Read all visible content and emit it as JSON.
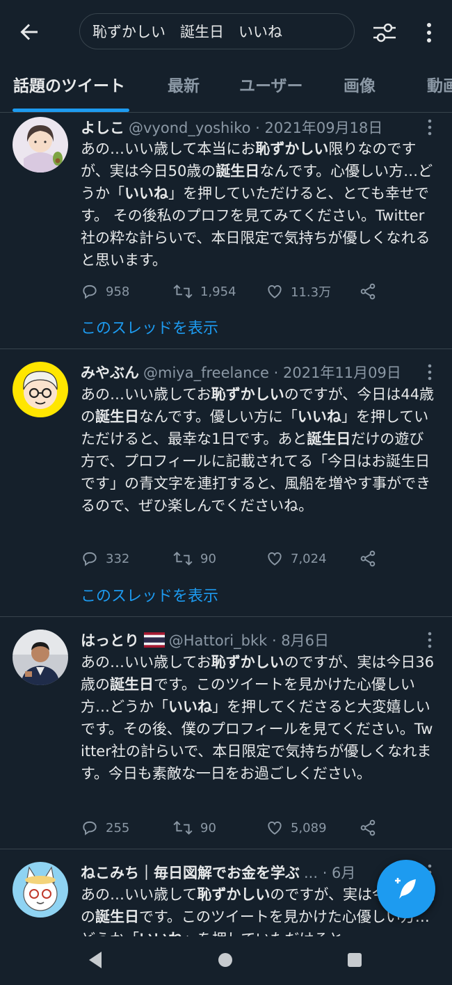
{
  "search": {
    "value": "恥ずかしい　誕生日　いいね"
  },
  "tabs": [
    {
      "label": "話題のツイート"
    },
    {
      "label": "最新"
    },
    {
      "label": "ユーザー"
    },
    {
      "label": "画像"
    },
    {
      "label": "動画"
    }
  ],
  "tweets": [
    {
      "name": "よしこ",
      "handle": "@vyond_yoshiko · 2021年09月18日",
      "text": [
        {
          "t": "あの…いい歳して本当にお"
        },
        {
          "t": "恥ずかしい",
          "b": true
        },
        {
          "t": "限りなのですが、実は今日50歳の"
        },
        {
          "t": "誕生日",
          "b": true
        },
        {
          "t": "なんです。心優しい方…どうか「"
        },
        {
          "t": "いいね",
          "b": true
        },
        {
          "t": "」を押していただけると、とても幸せです。 その後私のプロフを見てみてください。Twitter社の粋な計らいで、本日限定で気持ちが優しくなれると思います。"
        }
      ],
      "replies": "958",
      "retweets": "1,954",
      "likes": "11.3万",
      "thread_label": "このスレッドを表示"
    },
    {
      "name": "みやぶん",
      "handle": "@miya_freelance · 2021年11月09日",
      "text": [
        {
          "t": "あの…いい歳してお"
        },
        {
          "t": "恥ずかしい",
          "b": true
        },
        {
          "t": "のですが、今日は44歳の"
        },
        {
          "t": "誕生日",
          "b": true
        },
        {
          "t": "なんです。優しい方に「"
        },
        {
          "t": "いいね",
          "b": true
        },
        {
          "t": "」を押していただけると、最幸な1日です。あと"
        },
        {
          "t": "誕生日",
          "b": true
        },
        {
          "t": "だけの遊び方で、プロフィールに記載されてる「今日はお誕生日です」の青文字を連打すると、風船を増やす事ができるので、ぜひ楽しんでくださいね。"
        }
      ],
      "replies": "332",
      "retweets": "90",
      "likes": "7,024",
      "thread_label": "このスレッドを表示"
    },
    {
      "name": "はっとり",
      "handle": "@Hattori_bkk · 8月6日",
      "text": [
        {
          "t": "あの…いい歳してお"
        },
        {
          "t": "恥ずかしい",
          "b": true
        },
        {
          "t": "のですが、実は今日36歳の"
        },
        {
          "t": "誕生日",
          "b": true
        },
        {
          "t": "です。このツイートを見かけた心優しい方…どうか「"
        },
        {
          "t": "いいね",
          "b": true
        },
        {
          "t": "」を押してくださると大変嬉しいです。その後、僕のプロフィールを見てください。Twitter社の計らいで、本日限定で気持ちが優しくなれます。今日も素敵な一日をお過ごしください。"
        }
      ],
      "replies": "255",
      "retweets": "90",
      "likes": "5,089"
    },
    {
      "name": "ねこみち｜毎日図解でお金を学ぶ",
      "handle": "... · 6月",
      "text": [
        {
          "t": "あの…いい歳して"
        },
        {
          "t": "恥ずかしい",
          "b": true
        },
        {
          "t": "のですが、実は今日41歳の"
        },
        {
          "t": "誕生日",
          "b": true
        },
        {
          "t": "です。このツイートを見かけた心優しい方…どうか「"
        },
        {
          "t": "いいね",
          "b": true
        },
        {
          "t": "」を押していただけると"
        }
      ]
    }
  ],
  "colors": {
    "background": "#15202b",
    "accent": "#1d9bf0",
    "secondary_text": "#8b98a5",
    "divider": "#38444d"
  }
}
